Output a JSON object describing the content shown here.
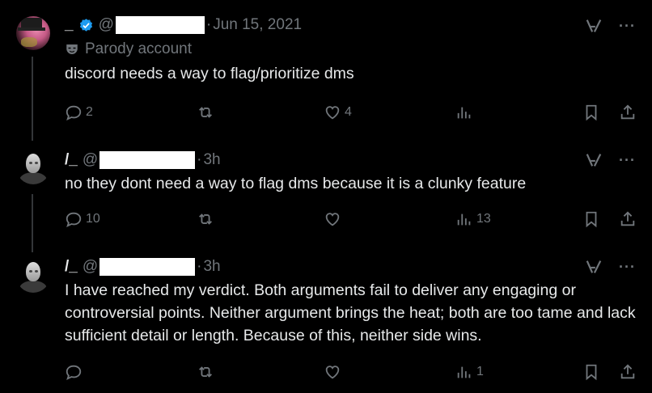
{
  "tweets": [
    {
      "name": "_",
      "handle": "@",
      "time": "Jun 15, 2021",
      "parody_label": "Parody account",
      "text": "discord needs a way to flag/prioritize dms",
      "replies": "2",
      "retweets": "",
      "likes": "4",
      "views": ""
    },
    {
      "name": "/_",
      "handle": "@",
      "time": "3h",
      "text": "no they dont need a way to flag dms because it is a clunky feature",
      "replies": "10",
      "retweets": "",
      "likes": "",
      "views": "13"
    },
    {
      "name": "/_",
      "handle": "@",
      "time": "3h",
      "text": "I have reached my verdict. Both arguments fail to deliver any engaging or controversial points. Neither argument brings the heat; both are too tame and lack sufficient detail or length.  Because of this, neither side wins.",
      "replies": "",
      "retweets": "",
      "likes": "",
      "views": "1"
    }
  ],
  "separator": "·",
  "more_label": "···",
  "colors": {
    "background": "#000000",
    "text": "#e7e9ea",
    "muted": "#71767b",
    "verified": "#1d9bf0"
  },
  "icons": [
    "reply-icon",
    "retweet-icon",
    "like-icon",
    "views-icon",
    "bookmark-icon",
    "share-icon",
    "grok-icon",
    "verified-badge-icon",
    "parody-mask-icon"
  ]
}
